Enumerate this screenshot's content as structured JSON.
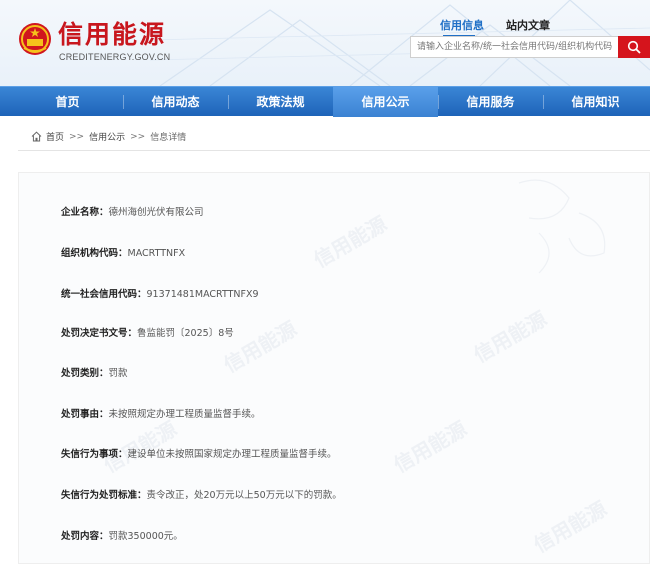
{
  "header": {
    "title": "信用能源",
    "subtitle": "CREDITENERGY.GOV.CN",
    "search_tabs": [
      "信用信息",
      "站内文章"
    ],
    "search_placeholder": "请输入企业名称/统一社会信用代码/组织机构代码"
  },
  "nav": {
    "items": [
      "首页",
      "信用动态",
      "政策法规",
      "信用公示",
      "信用服务",
      "信用知识"
    ],
    "active_index": 3
  },
  "breadcrumb": {
    "home": "首页",
    "sep": ">>",
    "level1": "信用公示",
    "current": "信息详情"
  },
  "details": [
    {
      "label": "企业名称：",
      "value": "德州海创光伏有限公司"
    },
    {
      "label": "组织机构代码：",
      "value": "MACRTTNFX"
    },
    {
      "label": "统一社会信用代码：",
      "value": "91371481MACRTTNFX9"
    },
    {
      "label": "处罚决定书文号：",
      "value": "鲁监能罚〔2025〕8号"
    },
    {
      "label": "处罚类别：",
      "value": "罚款"
    },
    {
      "label": "处罚事由：",
      "value": "未按照规定办理工程质量监督手续。"
    },
    {
      "label": "失信行为事项：",
      "value": "建设单位未按照国家规定办理工程质量监督手续。"
    },
    {
      "label": "失信行为处罚标准：",
      "value": "责令改正，处20万元以上50万元以下的罚款。"
    },
    {
      "label": "处罚内容：",
      "value": "罚款350000元。"
    }
  ],
  "colors": {
    "brand_red": "#c8161d",
    "nav_blue": "#1e63b8",
    "tab_blue": "#1f6fc6"
  },
  "icons": [
    "national-emblem-icon",
    "search-icon",
    "home-icon"
  ]
}
